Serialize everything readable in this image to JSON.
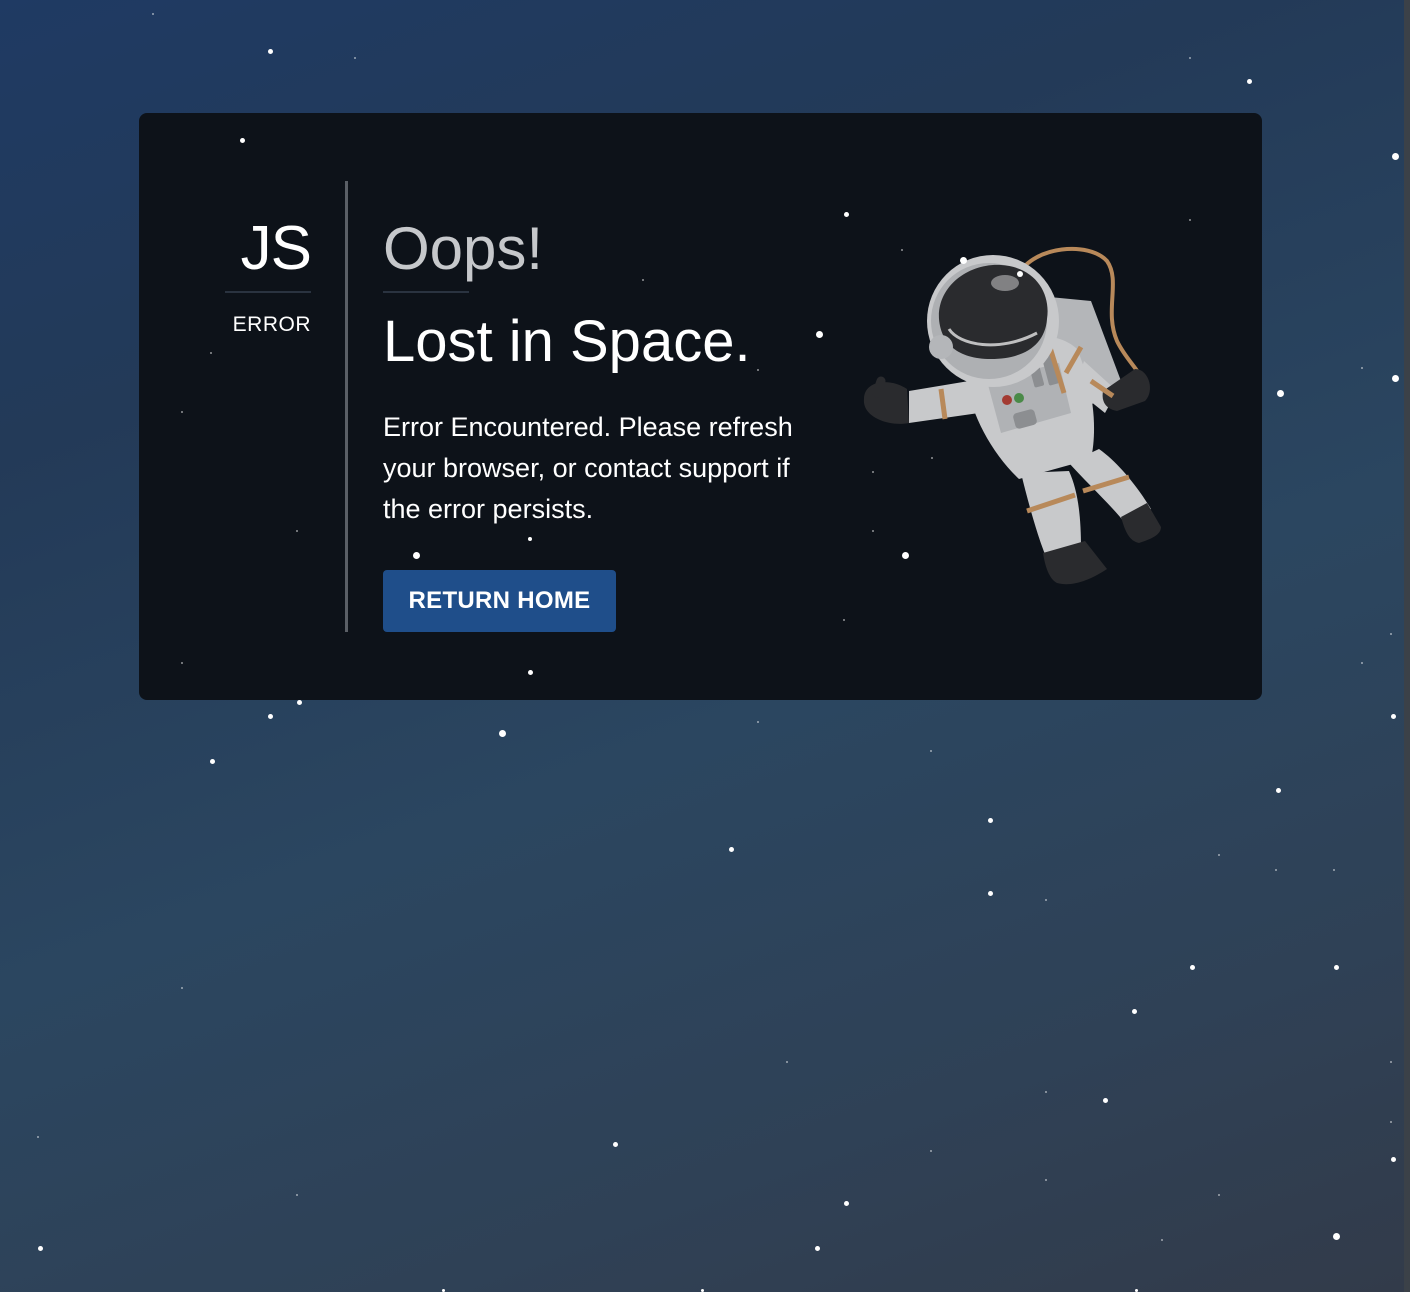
{
  "error_code": {
    "code": "JS",
    "label": "ERROR"
  },
  "main": {
    "exclamation": "Oops!",
    "headline": "Lost in Space.",
    "message": "Error Encountered. Please refresh your browser, or contact support if the error persists.",
    "button_label": "RETURN HOME"
  },
  "illustration": {
    "icon": "astronaut-icon"
  },
  "colors": {
    "card_background": "#0d1219",
    "button_background": "#1f4e8a",
    "exclamation_text": "#c6c8cb",
    "tether": "#b8895a"
  }
}
